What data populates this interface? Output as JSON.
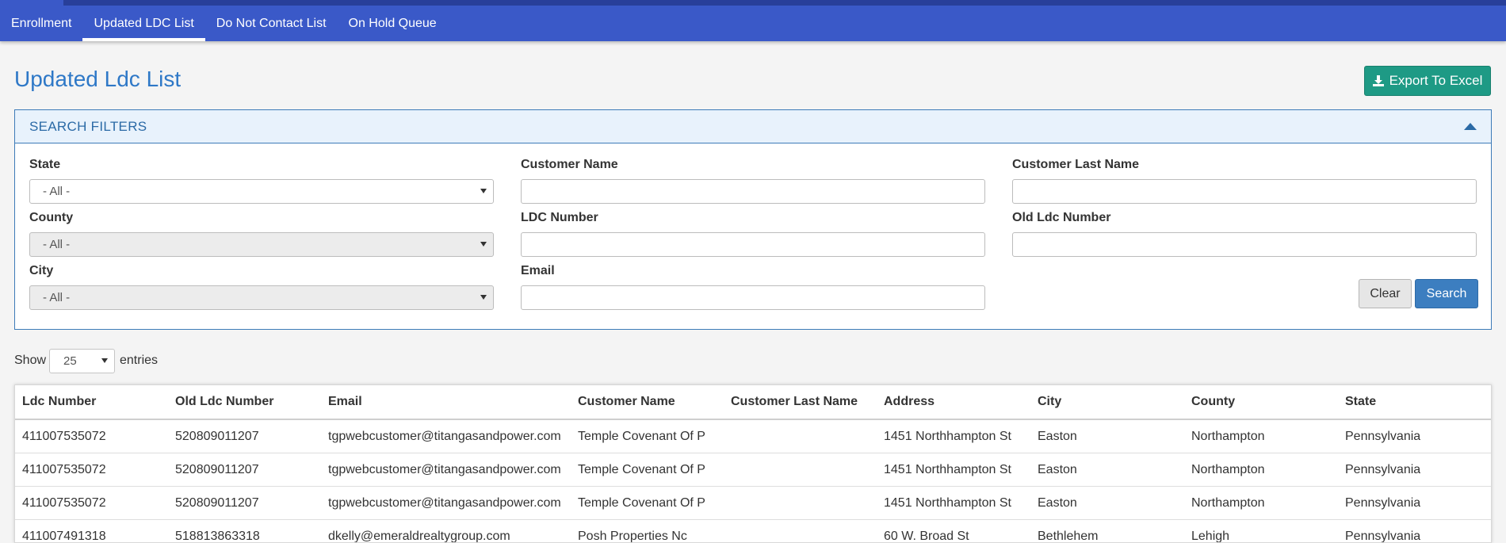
{
  "nav": {
    "items": [
      {
        "label": "Enrollment",
        "active": false
      },
      {
        "label": "Updated LDC List",
        "active": true
      },
      {
        "label": "Do Not Contact List",
        "active": false
      },
      {
        "label": "On Hold Queue",
        "active": false
      }
    ]
  },
  "page": {
    "title": "Updated Ldc List",
    "export_label": "Export To Excel"
  },
  "filters": {
    "panel_title": "SEARCH FILTERS",
    "state": {
      "label": "State",
      "value": "- All -"
    },
    "county": {
      "label": "County",
      "value": "- All -"
    },
    "city": {
      "label": "City",
      "value": "- All -"
    },
    "customer_name": {
      "label": "Customer Name",
      "value": ""
    },
    "ldc_number": {
      "label": "LDC Number",
      "value": ""
    },
    "email": {
      "label": "Email",
      "value": ""
    },
    "customer_last_name": {
      "label": "Customer Last Name",
      "value": ""
    },
    "old_ldc_number": {
      "label": "Old Ldc Number",
      "value": ""
    },
    "clear_label": "Clear",
    "search_label": "Search"
  },
  "length_menu": {
    "show": "Show",
    "value": "25",
    "entries": "entries"
  },
  "table": {
    "columns": [
      "Ldc Number",
      "Old Ldc Number",
      "Email",
      "Customer Name",
      "Customer Last Name",
      "Address",
      "City",
      "County",
      "State"
    ],
    "rows": [
      [
        "411007535072",
        "520809011207",
        "tgpwebcustomer@titangasandpower.com",
        "Temple Covenant Of P",
        "",
        "1451 Northhampton St",
        "Easton",
        "Northampton",
        "Pennsylvania"
      ],
      [
        "411007535072",
        "520809011207",
        "tgpwebcustomer@titangasandpower.com",
        "Temple Covenant Of P",
        "",
        "1451 Northhampton St",
        "Easton",
        "Northampton",
        "Pennsylvania"
      ],
      [
        "411007535072",
        "520809011207",
        "tgpwebcustomer@titangasandpower.com",
        "Temple Covenant Of P",
        "",
        "1451 Northhampton St",
        "Easton",
        "Northampton",
        "Pennsylvania"
      ],
      [
        "411007491318",
        "518813863318",
        "dkelly@emeraldrealtygroup.com",
        "Posh Properties Nc",
        "",
        "60 W. Broad St",
        "Bethlehem",
        "Lehigh",
        "Pennsylvania"
      ]
    ]
  },
  "colors": {
    "nav_bg": "#3a59c8",
    "title": "#2e78c7",
    "export_bg": "#1e9a85",
    "search_bg": "#3c7ec0"
  }
}
